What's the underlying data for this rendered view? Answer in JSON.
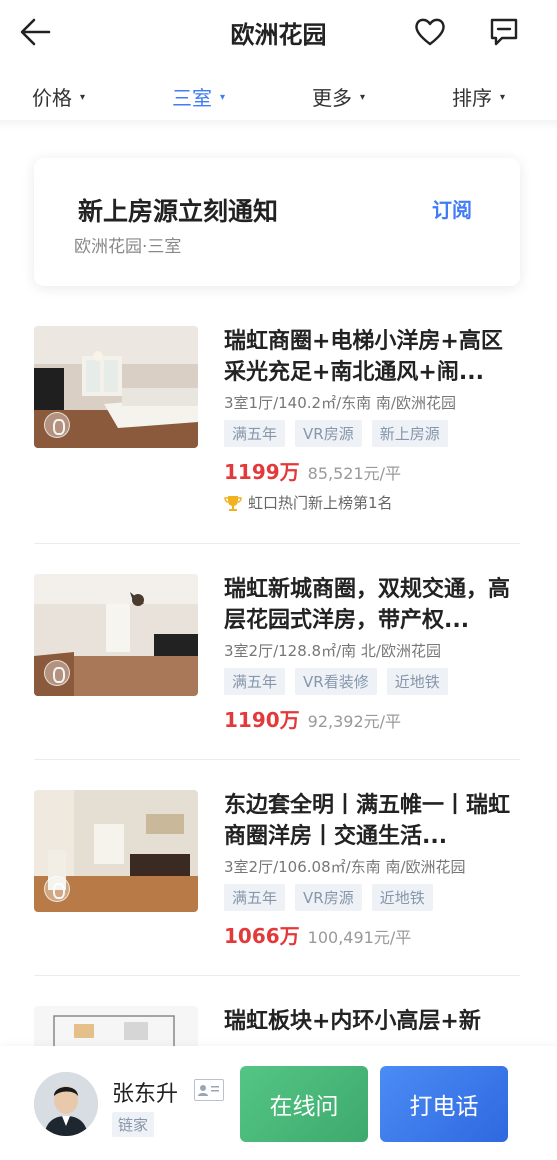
{
  "header": {
    "title": "欧洲花园",
    "back_icon": "arrow-left-icon",
    "favorite_icon": "heart-icon",
    "message_icon": "chat-icon"
  },
  "filters": [
    {
      "label": "价格",
      "active": false
    },
    {
      "label": "三室",
      "active": true
    },
    {
      "label": "更多",
      "active": false
    },
    {
      "label": "排序",
      "active": false
    }
  ],
  "colors": {
    "accent": "#3f7cf6",
    "price": "#e23a3a",
    "online_button": "#4cb97a",
    "call_button": "#3b78e8"
  },
  "subscribe": {
    "title": "新上房源立刻通知",
    "subtitle": "欧洲花园·三室",
    "button": "订阅"
  },
  "listings": [
    {
      "title": "瑞虹商圈+电梯小洋房+高区采光充足+南北通风+闹...",
      "meta": "3室1厅/140.2㎡/东南 南/欧洲花园",
      "tags": [
        "满五年",
        "VR房源",
        "新上房源"
      ],
      "price": "1199万",
      "unit_price": "85,521元/平",
      "rank": "虹口热门新上榜第1名"
    },
    {
      "title": "瑞虹新城商圈，双规交通，高层花园式洋房，带产权...",
      "meta": "3室2厅/128.8㎡/南 北/欧洲花园",
      "tags": [
        "满五年",
        "VR看装修",
        "近地铁"
      ],
      "price": "1190万",
      "unit_price": "92,392元/平"
    },
    {
      "title": "东边套全明丨满五帷一丨瑞虹商圈洋房丨交通生活...",
      "meta": "3室2厅/106.08㎡/东南 南/欧洲花园",
      "tags": [
        "满五年",
        "VR房源",
        "近地铁"
      ],
      "price": "1066万",
      "unit_price": "100,491元/平"
    },
    {
      "title": "瑞虹板块+内环小高层+新"
    }
  ],
  "agent": {
    "name": "张东升",
    "agency": "链家",
    "online_label": "在线问",
    "call_label": "打电话"
  }
}
